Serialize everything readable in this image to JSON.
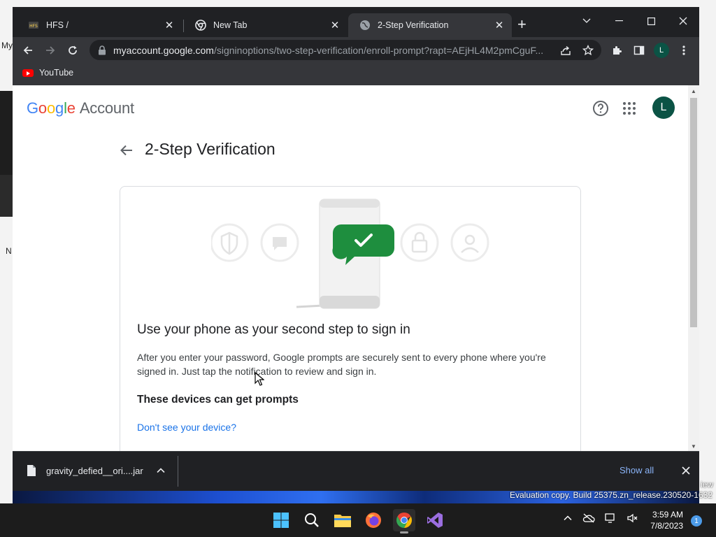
{
  "desktop": {
    "fragments": [
      "My",
      "N"
    ],
    "eval_watermark": "Evaluation copy. Build 25375.zn_release.230520-1632",
    "side_watermark": "iew"
  },
  "browser": {
    "tabs": [
      {
        "title": "HFS /",
        "icon": "hfs-icon",
        "active": false
      },
      {
        "title": "New Tab",
        "icon": "chrome-icon",
        "active": false
      },
      {
        "title": "2-Step Verification",
        "icon": "globe-icon",
        "active": true
      }
    ],
    "url_host": "myaccount.google.com",
    "url_path": "/signinoptions/two-step-verification/enroll-prompt?rapt=AEjHL4M2pmCguF...",
    "profile_initial": "L",
    "bookmarks": [
      {
        "label": "YouTube",
        "icon": "youtube-icon"
      }
    ]
  },
  "page": {
    "logo_word": "Google",
    "logo_suffix": "Account",
    "avatar_initial": "L",
    "title": "2-Step Verification",
    "card": {
      "heading": "Use your phone as your second step to sign in",
      "body": "After you enter your password, Google prompts are securely sent to every phone where you're signed in. Just tap the notification to review and sign in.",
      "devices_heading": "These devices can get prompts",
      "device_link": "Don't see your device?"
    }
  },
  "downloads": {
    "file_name": "gravity_defied__ori....jar",
    "show_all": "Show all"
  },
  "taskbar": {
    "apps": [
      "windows-start",
      "search",
      "file-explorer",
      "firefox",
      "chrome",
      "visual-studio"
    ],
    "active_app": "chrome",
    "time": "3:59 AM",
    "date": "7/8/2023",
    "notifications": "1"
  },
  "colors": {
    "google_blue": "#4285f4",
    "google_red": "#ea4335",
    "google_yellow": "#fbbc05",
    "google_green": "#34a853",
    "avatar_bg": "#0b5345",
    "link_blue": "#1a73e8",
    "check_green": "#1e8e3e"
  }
}
